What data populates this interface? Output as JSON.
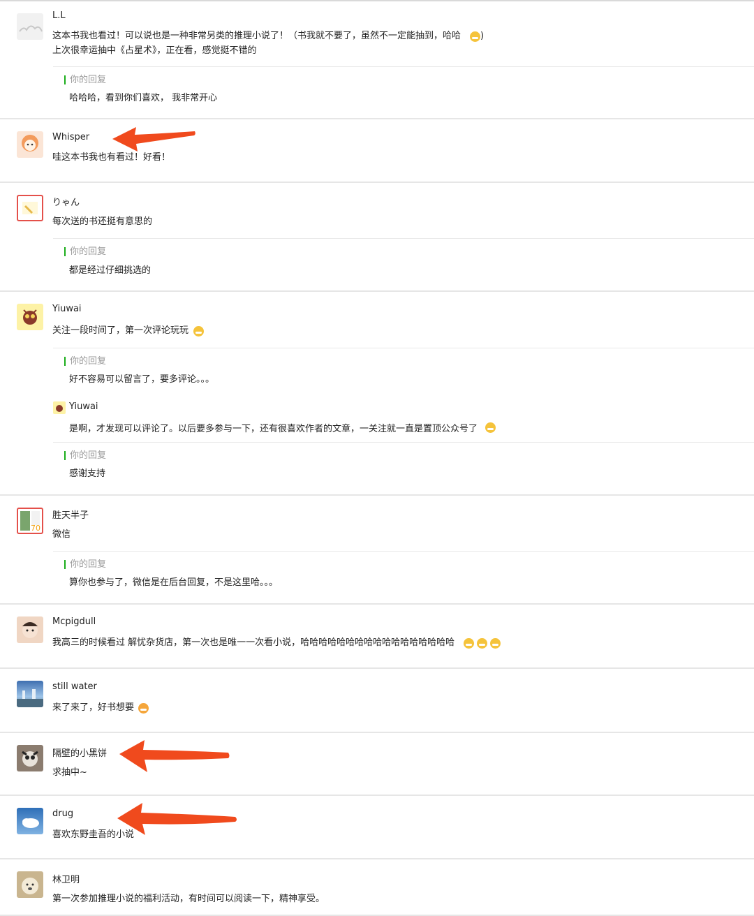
{
  "reply_label": "你的回复",
  "accent": "#1aad19",
  "arrow_color": "#f04a1d",
  "comments": [
    {
      "nick": "L.L",
      "lines": [
        "这本书我也看过！可以说也是一种非常另类的推理小说了！（书我就不要了，虽然不一定能抽到，哈哈",
        "上次很幸运抽中《占星术》，正在看，感觉挺不错的"
      ],
      "emoji": "thinking-emoji",
      "reply": "哈哈哈，看到你们喜欢， 我非常开心"
    },
    {
      "nick": "Whisper",
      "text": "哇这本书我也有看过！好看！"
    },
    {
      "nick": "りゃん",
      "text": "每次送的书还挺有意思的",
      "reply": "都是经过仔细挑选的"
    },
    {
      "nick": "Yiuwai",
      "text": "关注一段时间了，第一次评论玩玩",
      "emoji": "grin-emoji",
      "reply": "好不容易可以留言了，要多评论。。。",
      "followup": {
        "nick": "Yiuwai",
        "text": "是啊，才发现可以评论了。以后要多参与一下，还有很喜欢作者的文章，一关注就一直是置顶公众号了",
        "emoji": "sunglasses-emoji",
        "reply": "感谢支持"
      }
    },
    {
      "nick": "胜天半子",
      "text": "微信",
      "reply": "算你也参与了，微信是在后台回复，不是这里哈。。。"
    },
    {
      "nick": "Mcpigdull",
      "text": "我高三的时候看过 解忧杂货店，第一次也是唯一一次看小说，哈哈哈哈哈哈哈哈哈哈哈哈哈哈哈哈哈",
      "emoji": "grin-emoji"
    },
    {
      "nick": "still water",
      "text": "来了来了，好书想要",
      "emoji": "astonished-emoji"
    },
    {
      "nick": "隔壁的小黑饼",
      "text": "求抽中~"
    },
    {
      "nick": "drug",
      "text": "喜欢东野圭吾的小说"
    },
    {
      "nick": "林卫明",
      "text": "第一次参加推理小说的福利活动，有时间可以阅读一下，精神享受。"
    }
  ]
}
